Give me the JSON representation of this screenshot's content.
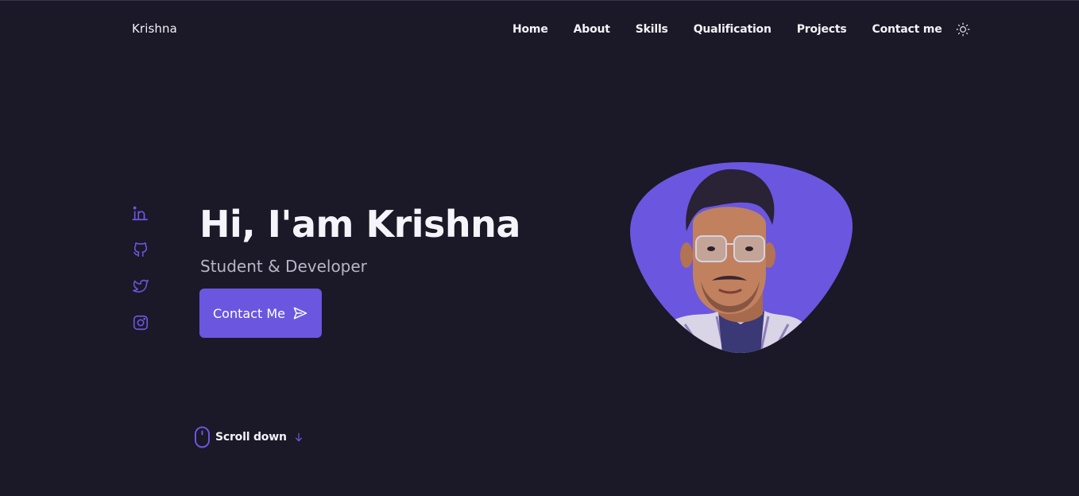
{
  "brand": {
    "name": "Krishna"
  },
  "nav": {
    "items": [
      {
        "label": "Home"
      },
      {
        "label": "About"
      },
      {
        "label": "Skills"
      },
      {
        "label": "Qualification"
      },
      {
        "label": "Projects"
      },
      {
        "label": "Contact me"
      }
    ],
    "theme_icon": "sun-icon"
  },
  "social": {
    "items": [
      {
        "icon": "linkedin-icon"
      },
      {
        "icon": "github-icon"
      },
      {
        "icon": "twitter-icon"
      },
      {
        "icon": "instagram-icon"
      }
    ]
  },
  "hero": {
    "title": "Hi, I'am Krishna",
    "subtitle": "Student & Developer",
    "cta_label": "Contact Me",
    "cta_icon": "send-icon"
  },
  "scroll": {
    "label": "Scroll down",
    "mouse_icon": "mouse-icon",
    "arrow_icon": "arrow-down-icon"
  },
  "colors": {
    "background": "#1b1827",
    "accent": "#6b56e0",
    "text": "#f3f2f8",
    "muted_text": "#b8b5c6"
  }
}
